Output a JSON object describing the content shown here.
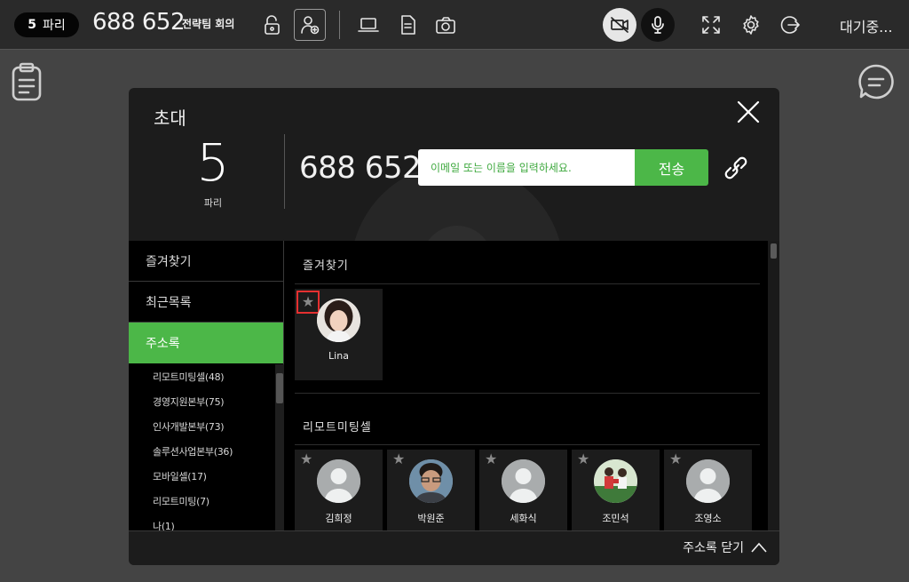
{
  "topbar": {
    "party_count": "5",
    "party_label": "파리",
    "meeting_number": "688 652",
    "meeting_name": "전략팀 회의",
    "status": "대기중..."
  },
  "modal": {
    "title": "초대",
    "party_count": "5",
    "party_label": "파리",
    "room_number": "688 652",
    "invite_placeholder": "이메일 또는 이름을 입력하세요.",
    "send_label": "전송",
    "sidebar": {
      "items": [
        {
          "label": "즐겨찾기"
        },
        {
          "label": "최근목록"
        },
        {
          "label": "주소록"
        }
      ],
      "groups": [
        {
          "label": "리모트미팅셀(48)"
        },
        {
          "label": "경영지원본부(75)"
        },
        {
          "label": "인사개발본부(73)"
        },
        {
          "label": "솔루션사업본부(36)"
        },
        {
          "label": "모바일셀(17)"
        },
        {
          "label": "리모트미팅(7)"
        },
        {
          "label": "나(1)"
        }
      ]
    },
    "sections": [
      {
        "title": "즐겨찾기"
      },
      {
        "title": "리모트미팅셀"
      }
    ],
    "favorites": [
      {
        "name": "Lina"
      }
    ],
    "contacts": [
      {
        "name": "김희정"
      },
      {
        "name": "박원준"
      },
      {
        "name": "세화식"
      },
      {
        "name": "조민석"
      },
      {
        "name": "조영소"
      }
    ],
    "close_addressbook": "주소록 닫기"
  },
  "colors": {
    "accent": "#4cb748",
    "highlight": "#e53030"
  }
}
